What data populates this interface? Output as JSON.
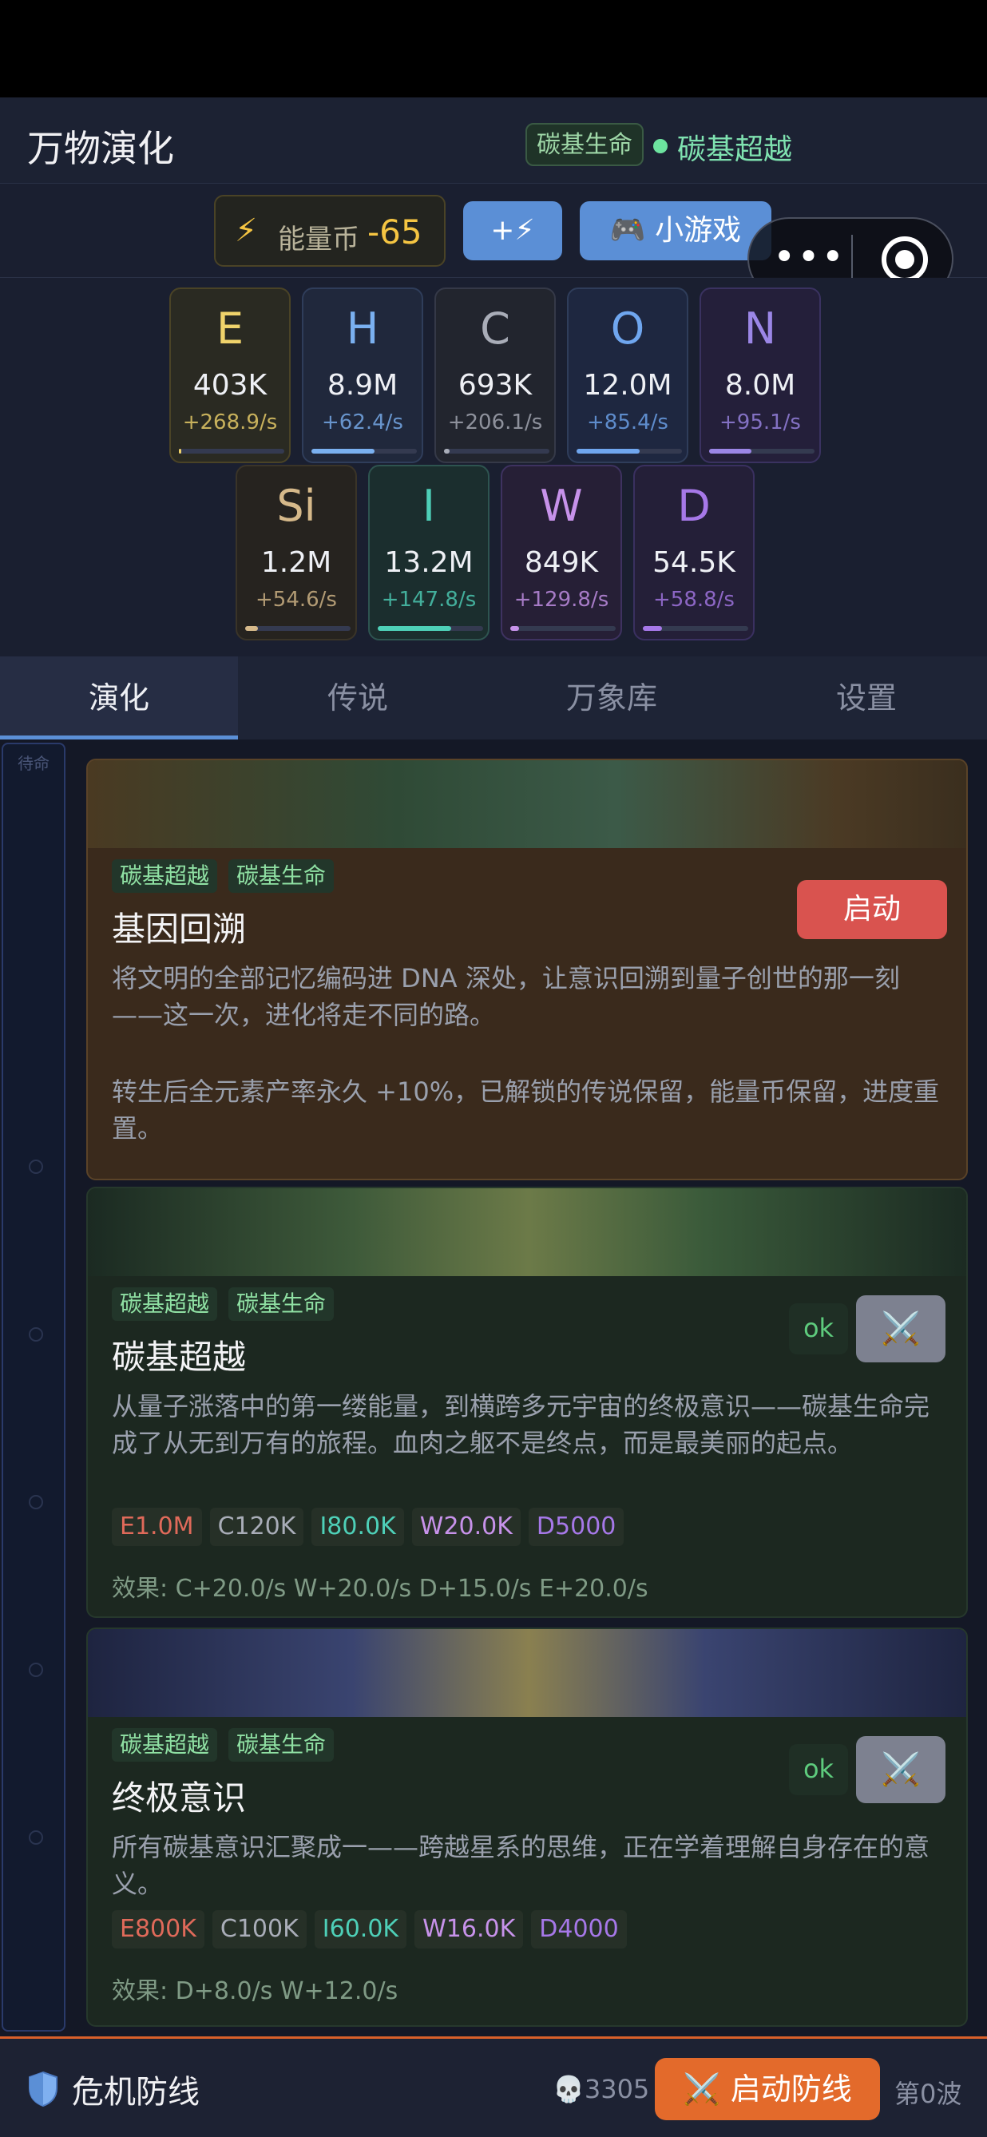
{
  "header": {
    "title": "万物演化",
    "era_tag": "碳基生命",
    "era_current": "碳基超越"
  },
  "toolbar": {
    "energy_label": "能量币",
    "energy_value": "-65",
    "buy_label": "+⚡",
    "game_label": "🎮 小游戏"
  },
  "elements": [
    {
      "symbol": "E",
      "amount": "403K",
      "rate": "+268.9/s",
      "color": "#f0d36b",
      "progress": 0.02
    },
    {
      "symbol": "H",
      "amount": "8.9M",
      "rate": "+62.4/s",
      "color": "#7ab0f0",
      "progress": 0.6
    },
    {
      "symbol": "C",
      "amount": "693K",
      "rate": "+206.1/s",
      "color": "#a9adb8",
      "progress": 0.05
    },
    {
      "symbol": "O",
      "amount": "12.0M",
      "rate": "+85.4/s",
      "color": "#6fa6ef",
      "progress": 0.6
    },
    {
      "symbol": "N",
      "amount": "8.0M",
      "rate": "+95.1/s",
      "color": "#9b86e6",
      "progress": 0.4
    },
    {
      "symbol": "Si",
      "amount": "1.2M",
      "rate": "+54.6/s",
      "color": "#d6b98a",
      "progress": 0.12
    },
    {
      "symbol": "I",
      "amount": "13.2M",
      "rate": "+147.8/s",
      "color": "#4ed0b8",
      "progress": 0.7
    },
    {
      "symbol": "W",
      "amount": "849K",
      "rate": "+129.8/s",
      "color": "#c792ea",
      "progress": 0.08
    },
    {
      "symbol": "D",
      "amount": "54.5K",
      "rate": "+58.8/s",
      "color": "#a678e8",
      "progress": 0.18
    }
  ],
  "tabs": [
    {
      "label": "演化",
      "active": true
    },
    {
      "label": "传说",
      "active": false
    },
    {
      "label": "万象库",
      "active": false
    },
    {
      "label": "设置",
      "active": false
    }
  ],
  "sidebar": {
    "label": "待命"
  },
  "cards": [
    {
      "tags": [
        "碳基超越",
        "碳基生命"
      ],
      "title": "基因回溯",
      "button": "启动",
      "desc1": "将文明的全部记忆编码进 DNA 深处，让意识回溯到量子创世的那一刻——这一次，进化将走不同的路。",
      "desc2": "转生后全元素产率永久 +10%，已解锁的传说保留，能量币保留，进度重置。"
    },
    {
      "tags": [
        "碳基超越",
        "碳基生命"
      ],
      "title": "碳基超越",
      "ok": "ok",
      "fight": "⚔️",
      "desc": "从量子涨落中的第一缕能量，到横跨多元宇宙的终极意识——碳基生命完成了从无到万有的旅程。血肉之躯不是终点，而是最美丽的起点。",
      "costs": [
        {
          "text": "E1.0M",
          "color": "#e06a5a"
        },
        {
          "text": "C120K",
          "color": "#a9adb8"
        },
        {
          "text": "I80.0K",
          "color": "#4ed0b8"
        },
        {
          "text": "W20.0K",
          "color": "#c792ea"
        },
        {
          "text": "D5000",
          "color": "#a678e8"
        }
      ],
      "effect": "效果: C+20.0/s  W+20.0/s  D+15.0/s  E+20.0/s"
    },
    {
      "tags": [
        "碳基超越",
        "碳基生命"
      ],
      "title": "终极意识",
      "ok": "ok",
      "fight": "⚔️",
      "desc": "所有碳基意识汇聚成一——跨越星系的思维，正在学着理解自身存在的意义。",
      "costs": [
        {
          "text": "E800K",
          "color": "#e06a5a"
        },
        {
          "text": "C100K",
          "color": "#a9adb8"
        },
        {
          "text": "I60.0K",
          "color": "#4ed0b8"
        },
        {
          "text": "W16.0K",
          "color": "#c792ea"
        },
        {
          "text": "D4000",
          "color": "#a678e8"
        }
      ],
      "effect": "效果: D+8.0/s  W+12.0/s"
    }
  ],
  "bottom": {
    "title": "危机防线",
    "kills": "💀3305",
    "start": "⚔️ 启动防线",
    "wave": "第0波"
  }
}
